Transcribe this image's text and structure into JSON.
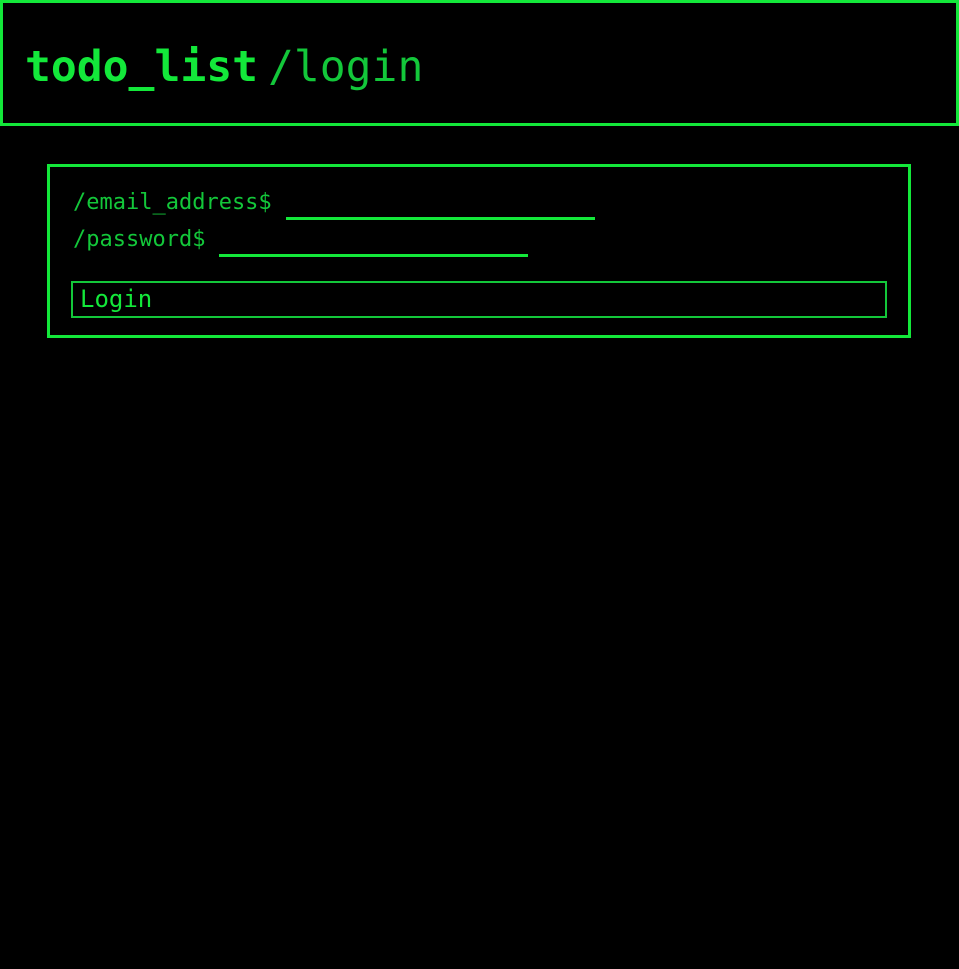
{
  "header": {
    "app_name": "todo_list",
    "route": "/login"
  },
  "login_form": {
    "email_prompt": "/email_address$",
    "email_value": "",
    "password_prompt": "/password$",
    "password_value": "",
    "submit_label": "Login"
  },
  "theme": {
    "background": "#000000",
    "accent": "#13e83a"
  }
}
